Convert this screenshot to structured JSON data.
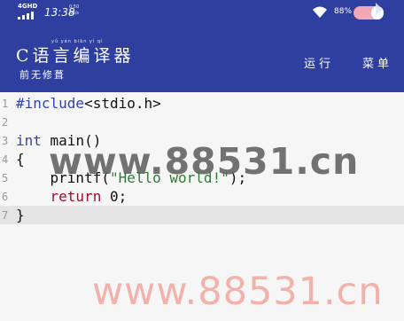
{
  "status_bar": {
    "network": "4GHD",
    "time": "13:38",
    "speed_value": "0.50",
    "speed_unit": "KB/s",
    "battery_percent": "88%",
    "icons": [
      "signal-icon",
      "wifi-icon",
      "battery-icon"
    ]
  },
  "app_bar": {
    "title": "C语言编译器",
    "title_ruby": "yǔ yán biān yì qì",
    "subtitle": "前无修葺",
    "actions": {
      "run": "运行",
      "menu": "菜单"
    },
    "color": "#2f3fa0"
  },
  "editor": {
    "lines": [
      {
        "number": "1",
        "parts": [
          "#include",
          "<stdio.h>"
        ]
      },
      {
        "number": "2",
        "parts": []
      },
      {
        "number": "3",
        "parts": [
          "int",
          " main()"
        ]
      },
      {
        "number": "4",
        "parts": [
          "{"
        ]
      },
      {
        "number": "5",
        "parts": [
          "    printf(",
          "\"Hello world!\"",
          ");"
        ]
      },
      {
        "number": "6",
        "parts": [
          "    ",
          "return",
          " 0;"
        ]
      },
      {
        "number": "7",
        "parts": [
          "}"
        ]
      }
    ],
    "active_line": "7"
  },
  "watermarks": [
    "www.88531.cn",
    "www.88531.cn"
  ]
}
